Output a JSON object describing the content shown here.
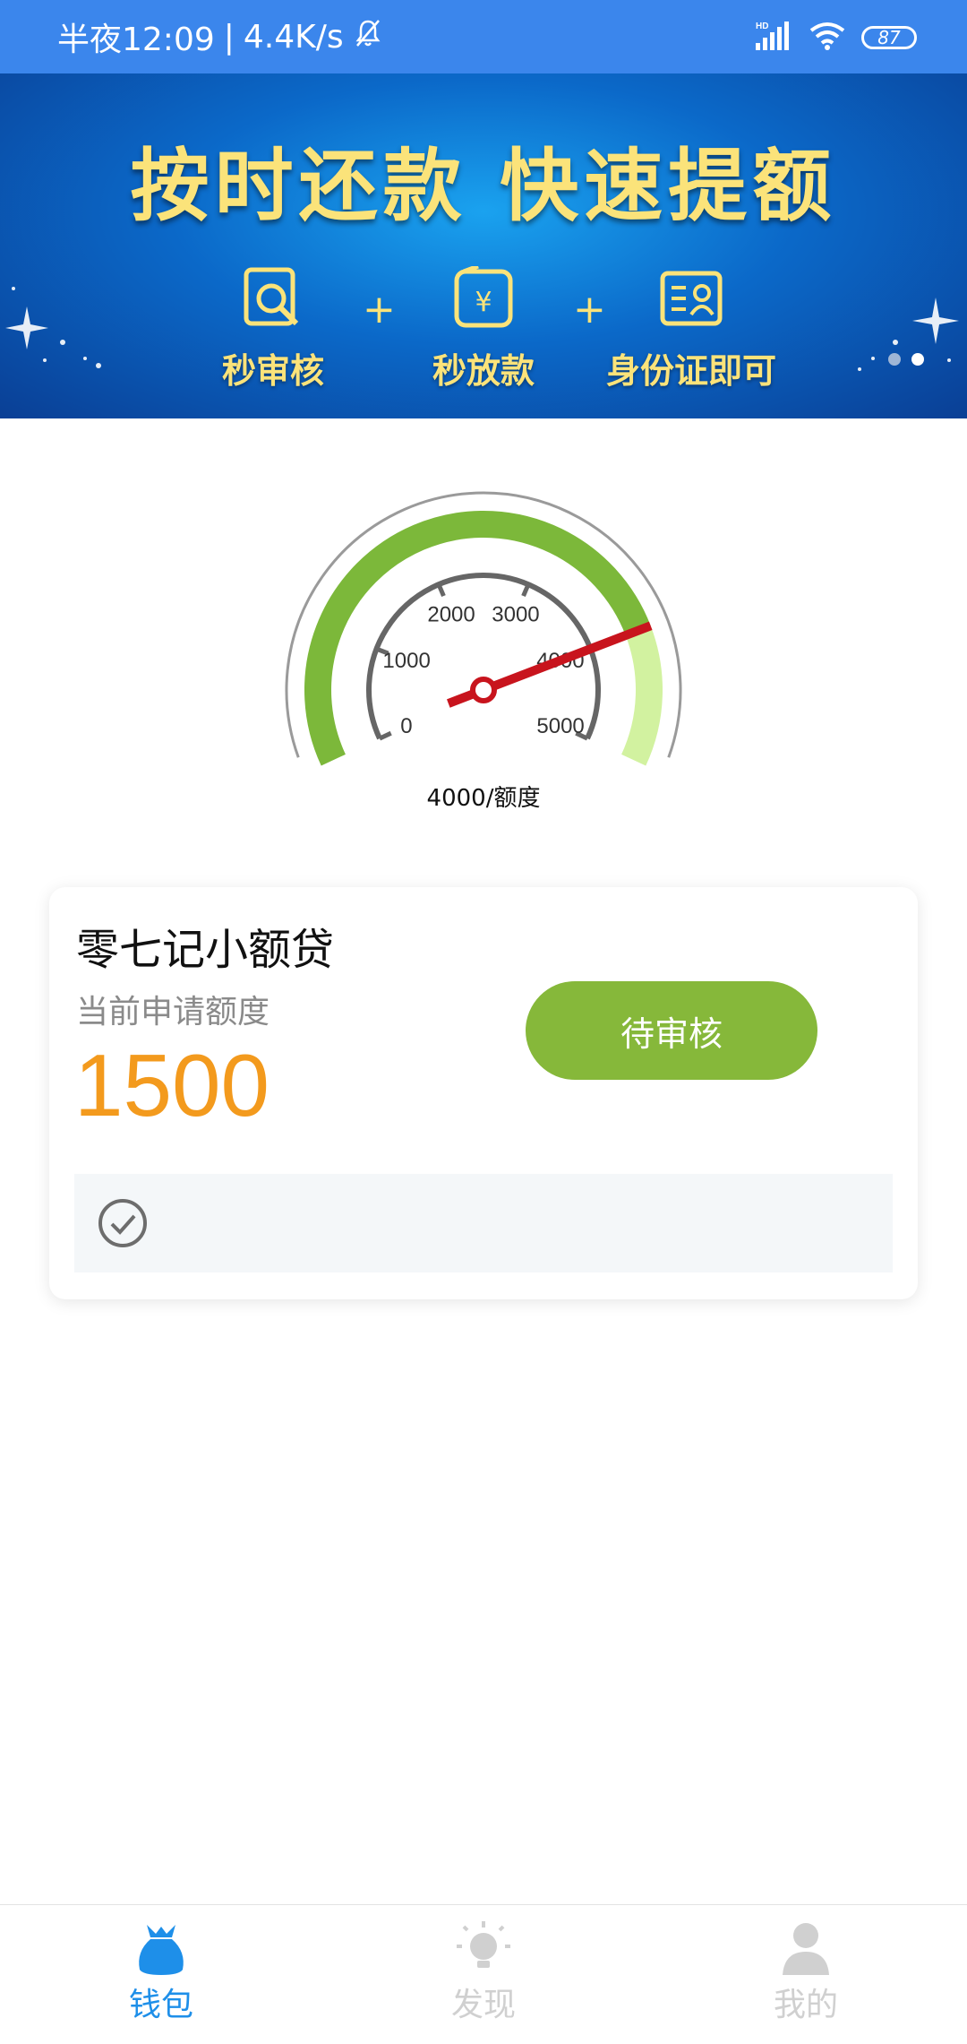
{
  "status_bar": {
    "time": "半夜12:09",
    "separator": "|",
    "speed": "4.4K/s",
    "network": "HD",
    "battery": "87"
  },
  "banner": {
    "title": "按时还款  快速提额",
    "features": [
      {
        "label": "秒审核",
        "icon": "magnifier-icon"
      },
      {
        "label": "秒放款",
        "icon": "yen-wallet-icon"
      },
      {
        "label": "身份证即可",
        "icon": "id-card-icon"
      }
    ],
    "plus": "+",
    "yen_symbol": "¥",
    "active_slide": 2,
    "slide_count": 2
  },
  "gauge": {
    "ticks": [
      "0",
      "1000",
      "2000",
      "3000",
      "4000",
      "5000"
    ],
    "value": 4000,
    "max": 5000,
    "caption": "4000/额度"
  },
  "loan_card": {
    "title": "零七记小额贷",
    "subtitle": "当前申请额度",
    "amount": "1500",
    "status_button": "待审核"
  },
  "tabs": [
    {
      "label": "钱包",
      "icon": "wallet-bag-icon",
      "active": true
    },
    {
      "label": "发现",
      "icon": "lightbulb-icon",
      "active": false
    },
    {
      "label": "我的",
      "icon": "person-icon",
      "active": false
    }
  ],
  "colors": {
    "status_bar": "#3b86ec",
    "accent": "#1e8fe9",
    "button_green": "#86b83a",
    "amount_orange": "#f39a1d",
    "tab_inactive": "#d0d0d0"
  }
}
